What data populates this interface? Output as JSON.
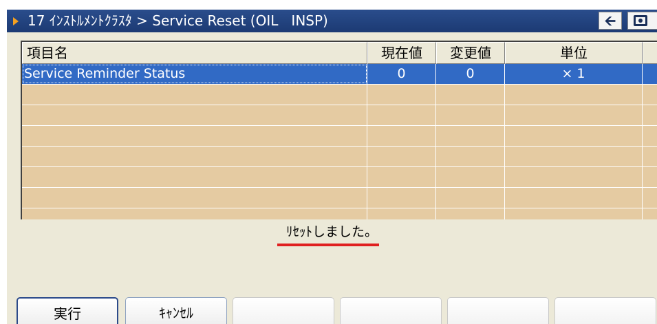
{
  "titlebar": {
    "title": "17 ｲﾝｽﾄﾙﾒﾝﾄｸﾗｽﾀ > Service Reset (OIL   INSP)",
    "back_icon": "back-arrow-icon",
    "camera_icon": "camera-icon"
  },
  "table": {
    "headers": [
      "項目名",
      "現在値",
      "変更値",
      "単位"
    ],
    "rows": [
      {
        "item": "Service Reminder Status",
        "current": "0",
        "changed": "0",
        "unit": "× 1",
        "selected": true
      }
    ],
    "empty_rows": 6
  },
  "status_message": "ﾘｾｯﾄしました。",
  "buttons": {
    "execute": "実行",
    "cancel": "ｷｬﾝｾﾙ"
  },
  "colors": {
    "titlebar": "#1c3a73",
    "grid_background": "#e5cba2",
    "selection": "#316ac5",
    "underline": "#e02020"
  }
}
